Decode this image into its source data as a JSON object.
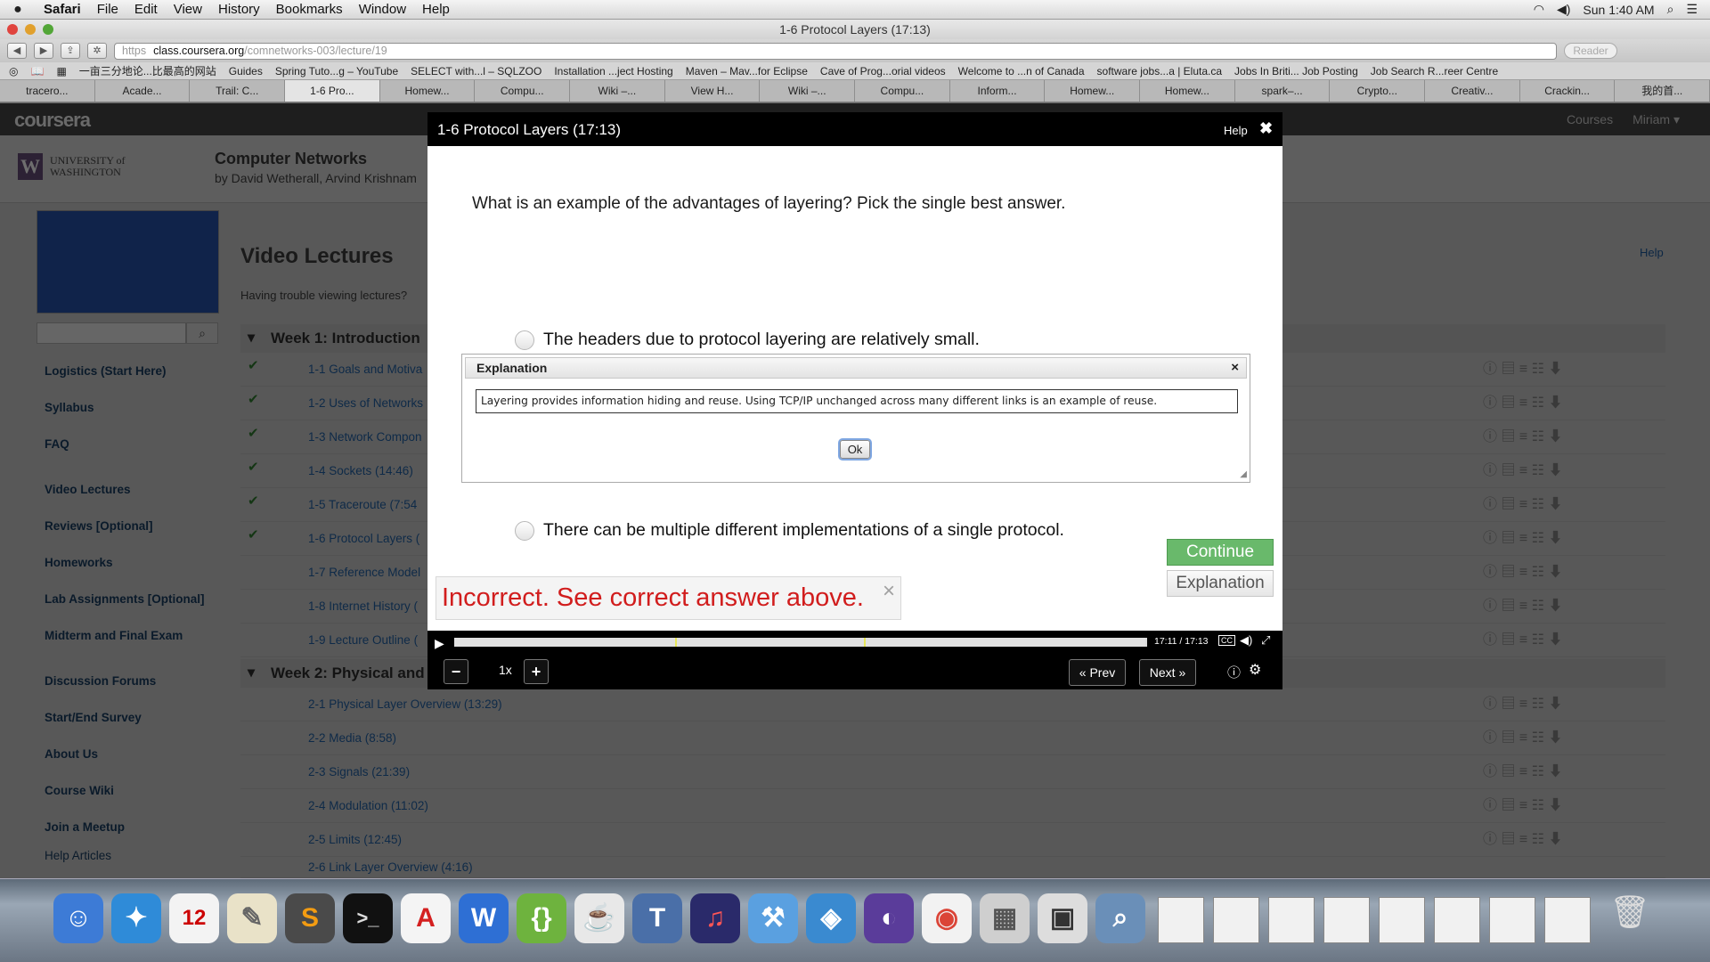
{
  "menubar": {
    "app": "Safari",
    "items": [
      "File",
      "Edit",
      "View",
      "History",
      "Bookmarks",
      "Window",
      "Help"
    ],
    "clock": "Sun 1:40 AM"
  },
  "window": {
    "title": "1-6 Protocol Layers (17:13)",
    "url_scheme": "https",
    "url_host": "class.coursera.org",
    "url_path": "/comnetworks-003/lecture/19",
    "reader": "Reader"
  },
  "bookmarks": [
    "一亩三分地论...比最高的网站",
    "Guides",
    "Spring Tuto...g – YouTube",
    "SELECT with...l – SQLZOO",
    "Installation ...ject Hosting",
    "Maven – Mav...for Eclipse",
    "Cave of Prog...orial videos",
    "Welcome to ...n of Canada",
    "software jobs...a | Eluta.ca",
    "Jobs In Briti... Job Posting",
    "Job Search R...reer Centre"
  ],
  "tabs": [
    "tracero...",
    "Acade...",
    "Trail: C...",
    "1-6 Pro...",
    "Homew...",
    "Compu...",
    "Wiki –...",
    "View H...",
    "Wiki –...",
    "Compu...",
    "Inform...",
    "Homew...",
    "Homew...",
    "spark–...",
    "Crypto...",
    "Creativ...",
    "Crackin...",
    "我的首..."
  ],
  "coursera": {
    "logo": "coursera",
    "nav": [
      "Courses",
      "Miriam ▾"
    ],
    "uni_line1": "UNIVERSITY of",
    "uni_line2": "WASHINGTON",
    "course_title": "Computer Networks",
    "course_sub": "by David Wetherall, Arvind Krishnam"
  },
  "sidebar": {
    "items": [
      "Logistics (Start Here)",
      "Syllabus",
      "FAQ",
      "Video Lectures",
      "Reviews [Optional]",
      "Homeworks",
      "Lab Assignments [Optional]",
      "Midterm and Final Exam",
      "Discussion Forums",
      "Start/End Survey",
      "About Us",
      "Course Wiki",
      "Join a Meetup",
      "Help Articles"
    ]
  },
  "main": {
    "title": "Video Lectures",
    "trouble": "Having trouble viewing lectures?",
    "help": "Help",
    "week1": "Week 1: Introduction",
    "week1_lectures": [
      "1-1 Goals and Motiva",
      "1-2 Uses of Networks",
      "1-3 Network Compon",
      "1-4 Sockets (14:46)",
      "1-5 Traceroute (7:54",
      "1-6 Protocol Layers (",
      "1-7 Reference Model",
      "1-8 Internet History (",
      "1-9 Lecture Outline ("
    ],
    "week2": "Week 2: Physical and",
    "week2_lectures": [
      "2-1 Physical Layer Overview (13:29)",
      "2-2 Media (8:58)",
      "2-3 Signals (21:39)",
      "2-4 Modulation (11:02)",
      "2-5 Limits (12:45)",
      "2-6 Link Layer Overview (4:16)"
    ]
  },
  "modal": {
    "title": "1-6 Protocol Layers (17:13)",
    "help": "Help",
    "question": "What is an example of the advantages of layering? Pick the single best answer.",
    "option1": "The headers due to protocol layering are relatively small.",
    "option2": "There can be multiple different implementations of a single protocol.",
    "explanation_title": "Explanation",
    "explanation_text": "Layering provides information hiding and reuse. Using TCP/IP unchanged across many different links is an example of reuse.",
    "ok": "Ok",
    "continue": "Continue",
    "explanation_button": "Explanation",
    "incorrect": "Incorrect. See correct answer above."
  },
  "player": {
    "time": "17:11 / 17:13",
    "progress": 0.998,
    "cc": "CC",
    "speed": "1x",
    "prev": "« Prev",
    "next": "Next »"
  },
  "colors": {
    "continue_green": "#69b96b",
    "incorrect_red": "#d11d1d",
    "modal_header": "#000000"
  }
}
